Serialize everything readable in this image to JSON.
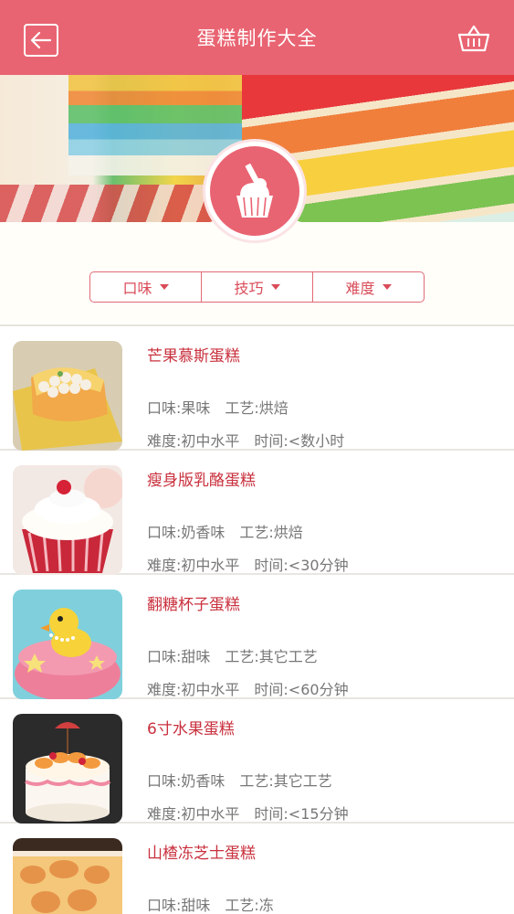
{
  "header": {
    "title": "蛋糕制作大全",
    "back_icon": "back-arrow-icon",
    "basket_icon": "basket-icon",
    "bg_color": "#e96472"
  },
  "filters": [
    {
      "label": "口味"
    },
    {
      "label": "技巧"
    },
    {
      "label": "难度"
    }
  ],
  "recipes": [
    {
      "title": "芒果慕斯蛋糕",
      "flavor": "口味:果味",
      "craft": "工艺:烘焙",
      "difficulty": "难度:初中水平",
      "time": "时间:<数小时"
    },
    {
      "title": "瘦身版乳酪蛋糕",
      "flavor": "口味:奶香味",
      "craft": "工艺:烘焙",
      "difficulty": "难度:初中水平",
      "time": "时间:<30分钟"
    },
    {
      "title": "翻糖杯子蛋糕",
      "flavor": "口味:甜味",
      "craft": "工艺:其它工艺",
      "difficulty": "难度:初中水平",
      "time": "时间:<60分钟"
    },
    {
      "title": "6寸水果蛋糕",
      "flavor": "口味:奶香味",
      "craft": "工艺:其它工艺",
      "difficulty": "难度:初中水平",
      "time": "时间:<15分钟"
    },
    {
      "title": "山楂冻芝士蛋糕",
      "flavor": "口味:甜味",
      "craft": "工艺:冻",
      "difficulty": "",
      "time": ""
    }
  ],
  "colors": {
    "accent": "#e96472",
    "title_red": "#c9313e",
    "meta_gray": "#777777"
  }
}
